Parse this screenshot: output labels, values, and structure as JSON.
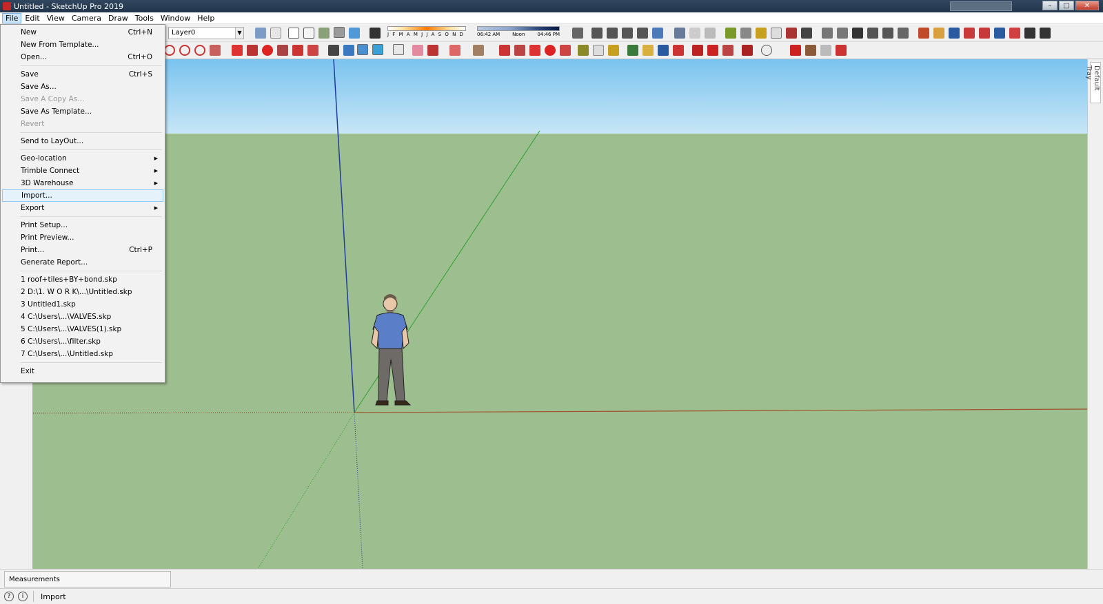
{
  "window": {
    "title": "Untitled - SketchUp Pro 2019"
  },
  "menubar": {
    "items": [
      "File",
      "Edit",
      "View",
      "Camera",
      "Draw",
      "Tools",
      "Window",
      "Help"
    ]
  },
  "toolbar": {
    "layer_selected": "Layer0",
    "shadow_months": "J F M A M J J A S O N D",
    "shadow_time_start": "06:42 AM",
    "shadow_time_mid": "Noon",
    "shadow_time_end": "04:46 PM"
  },
  "file_menu": {
    "new": {
      "label": "New",
      "shortcut": "Ctrl+N"
    },
    "new_from_template": {
      "label": "New From Template..."
    },
    "open": {
      "label": "Open...",
      "shortcut": "Ctrl+O"
    },
    "save": {
      "label": "Save",
      "shortcut": "Ctrl+S"
    },
    "save_as": {
      "label": "Save As..."
    },
    "save_copy_as": {
      "label": "Save A Copy As..."
    },
    "save_as_template": {
      "label": "Save As Template..."
    },
    "revert": {
      "label": "Revert"
    },
    "send_to_layout": {
      "label": "Send to LayOut..."
    },
    "geo_location": {
      "label": "Geo-location"
    },
    "trimble_connect": {
      "label": "Trimble Connect"
    },
    "warehouse": {
      "label": "3D Warehouse"
    },
    "import": {
      "label": "Import..."
    },
    "export": {
      "label": "Export"
    },
    "print_setup": {
      "label": "Print Setup..."
    },
    "print_preview": {
      "label": "Print Preview..."
    },
    "print": {
      "label": "Print...",
      "shortcut": "Ctrl+P"
    },
    "generate_report": {
      "label": "Generate Report..."
    },
    "recent": [
      "1 roof+tiles+BY+bond.skp",
      "2 D:\\1. W O R K\\...\\Untitled.skp",
      "3 Untitled1.skp",
      "4 C:\\Users\\...\\VALVES.skp",
      "5 C:\\Users\\...\\VALVES(1).skp",
      "6 C:\\Users\\...\\filter.skp",
      "7 C:\\Users\\...\\Untitled.skp"
    ],
    "exit": {
      "label": "Exit"
    }
  },
  "tray": {
    "label": "Default Tray"
  },
  "measurements": {
    "label": "Measurements"
  },
  "status": {
    "text": "Import"
  },
  "colors": {
    "sky": "#7ac3ef",
    "ground": "#9dbe8f",
    "axis_red": "#a0522d",
    "axis_green": "#2ca02c",
    "axis_blue": "#1f3c9a"
  }
}
